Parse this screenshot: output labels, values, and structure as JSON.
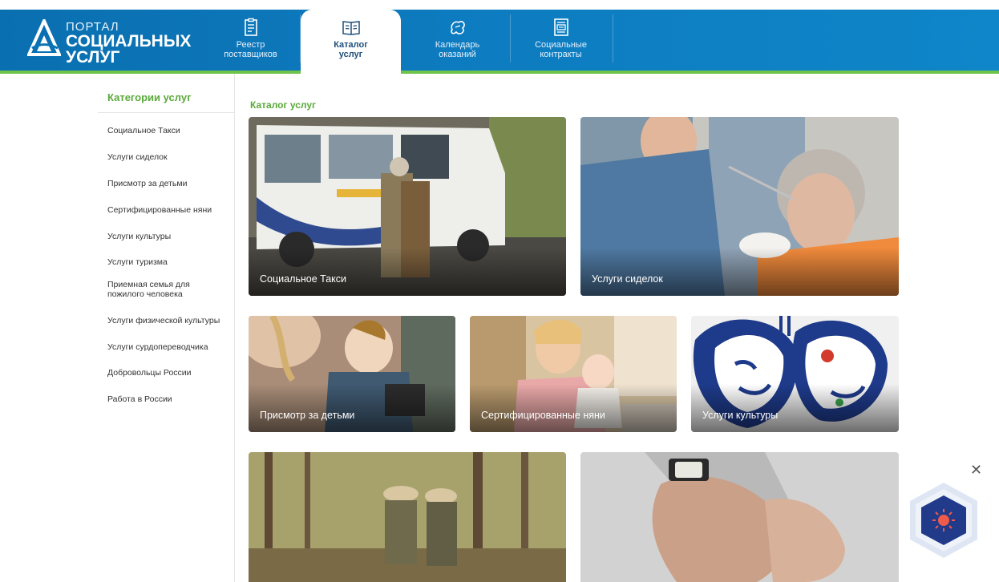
{
  "logo": {
    "line1": "ПОРТАЛ",
    "line2": "СОЦИАЛЬНЫХ",
    "line3": "УСЛУГ"
  },
  "nav": [
    {
      "label1": "Реестр",
      "label2": "поставщиков",
      "icon": "registry-icon",
      "active": false
    },
    {
      "label1": "Каталог",
      "label2": "услуг",
      "icon": "book-icon",
      "active": true
    },
    {
      "label1": "Календарь",
      "label2": "оказаний",
      "icon": "calendar-icon",
      "active": false
    },
    {
      "label1": "Социальные",
      "label2": "контракты",
      "icon": "contract-icon",
      "active": false
    }
  ],
  "sidebar": {
    "title": "Категории услуг",
    "items": [
      "Социальное Такси",
      "Услуги сиделок",
      "Присмотр за детьми",
      "Сертифицированные няни",
      "Услуги культуры",
      "Услуги туризма",
      "Приемная семья для пожилого человека",
      "Услуги физической культуры",
      "Услуги сурдопереводчика",
      "Добровольцы России",
      "Работа в России"
    ]
  },
  "main": {
    "title": "Каталог услуг",
    "cards": [
      "Социальное Такси",
      "Услуги сиделок",
      "Присмотр за детьми",
      "Сертифицированные няни",
      "Услуги культуры",
      "",
      ""
    ]
  },
  "widget": {
    "close": "✕"
  },
  "colors": {
    "header": "#0b74b6",
    "accent": "#6fc24a",
    "title": "#5aa93a"
  }
}
